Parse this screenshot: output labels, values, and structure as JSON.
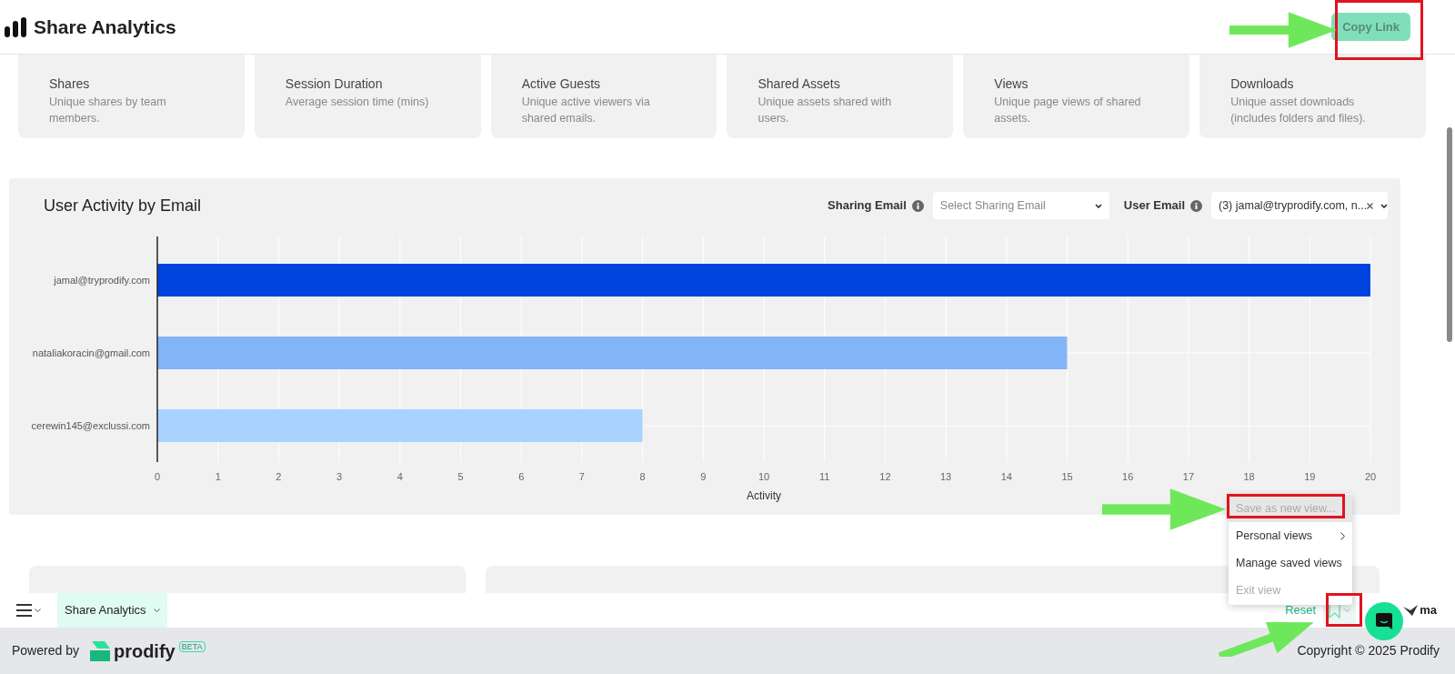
{
  "header": {
    "title": "Share Analytics",
    "copy_button": "Copy Link"
  },
  "cards": [
    {
      "title": "Shares",
      "description": "Unique shares by team members."
    },
    {
      "title": "Session Duration",
      "description": "Average session time (mins)"
    },
    {
      "title": "Active Guests",
      "description": "Unique active viewers via shared emails."
    },
    {
      "title": "Shared Assets",
      "description": "Unique assets shared with users."
    },
    {
      "title": "Views",
      "description": "Unique page views of shared assets."
    },
    {
      "title": "Downloads",
      "description": "Unique asset downloads (includes folders and files)."
    }
  ],
  "activity_panel": {
    "title": "User Activity by Email",
    "filters": [
      {
        "label": "Sharing Email",
        "placeholder": "Select Sharing Email"
      },
      {
        "label": "User Email",
        "value": "(3) jamal@tryprodify.com, n...",
        "clearable": true
      }
    ],
    "chart_data": {
      "type": "bar",
      "orientation": "horizontal",
      "stacked": true,
      "grid": true,
      "xlabel": "Activity",
      "series": [
        {
          "name": "jamal@tryprodify.com",
          "color": "#0044e0",
          "values": [
            20,
            null,
            null
          ]
        },
        {
          "name": "nataliakoracin@gmail.com",
          "color": "#84b4f8",
          "values": [
            null,
            15,
            null
          ]
        },
        {
          "name": "cerewin145@exclussi.com",
          "color": "#aad2ff",
          "values": [
            null,
            null,
            8
          ]
        }
      ],
      "xlim": [
        0,
        20
      ],
      "xticks": [
        0,
        1,
        2,
        3,
        4,
        5,
        6,
        7,
        8,
        9,
        10,
        11,
        12,
        13,
        14,
        15,
        16,
        17,
        18,
        19,
        20
      ]
    }
  },
  "view_menu": [
    {
      "label": "Save as new view...",
      "kind": "action",
      "disabled": true,
      "highlighted": true
    },
    {
      "label": "Personal views",
      "kind": "submenu",
      "disabled": false,
      "highlighted": false
    },
    {
      "label": "Manage saved views",
      "kind": "action",
      "disabled": false,
      "highlighted": false
    },
    {
      "label": "Exit view",
      "kind": "action",
      "disabled": true,
      "highlighted": false
    }
  ],
  "toolbar": {
    "tabs": [
      {
        "label": "Share Analytics",
        "selected": true
      }
    ],
    "reset": "Reset",
    "partial_label": "ma"
  },
  "footer": {
    "powered_by": "Powered by",
    "brand": "prodify",
    "badge": "BETA",
    "copyright": "Copyright © 2025 Prodify"
  }
}
